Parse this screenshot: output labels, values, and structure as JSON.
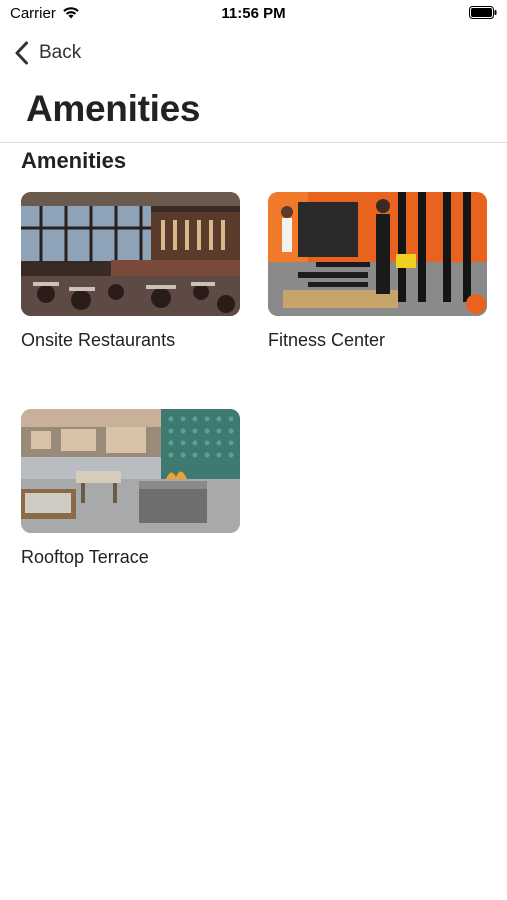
{
  "status": {
    "carrier": "Carrier",
    "time": "11:56 PM"
  },
  "nav": {
    "back_label": "Back"
  },
  "page": {
    "title": "Amenities"
  },
  "section": {
    "title": "Amenities"
  },
  "amenities": [
    {
      "label": "Onsite Restaurants"
    },
    {
      "label": "Fitness Center"
    },
    {
      "label": "Rooftop Terrace"
    }
  ]
}
